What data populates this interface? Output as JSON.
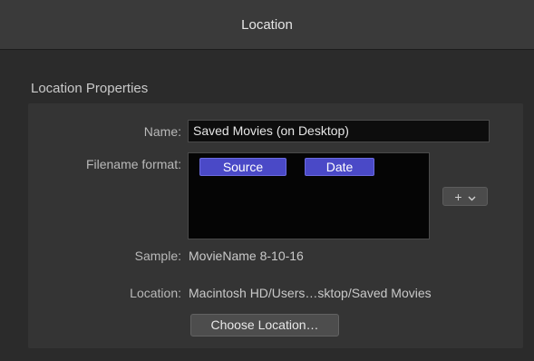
{
  "window": {
    "title": "Location"
  },
  "section": {
    "title": "Location Properties"
  },
  "fields": {
    "name_label": "Name:",
    "name_value": "Saved Movies (on Desktop)",
    "filename_format_label": "Filename format:",
    "tokens": [
      "Source",
      "Date"
    ],
    "sample_label": "Sample:",
    "sample_value": "MovieName 8-10-16",
    "location_label": "Location:",
    "location_value": "Macintosh HD/Users…sktop/Saved Movies"
  },
  "buttons": {
    "add_symbol": "+",
    "add_menu_icon": "chevron-down-icon",
    "choose_location": "Choose Location…"
  },
  "colors": {
    "token_background": "#4a49c7",
    "field_background": "#0d0d0d",
    "window_background": "#2b2b2b"
  }
}
